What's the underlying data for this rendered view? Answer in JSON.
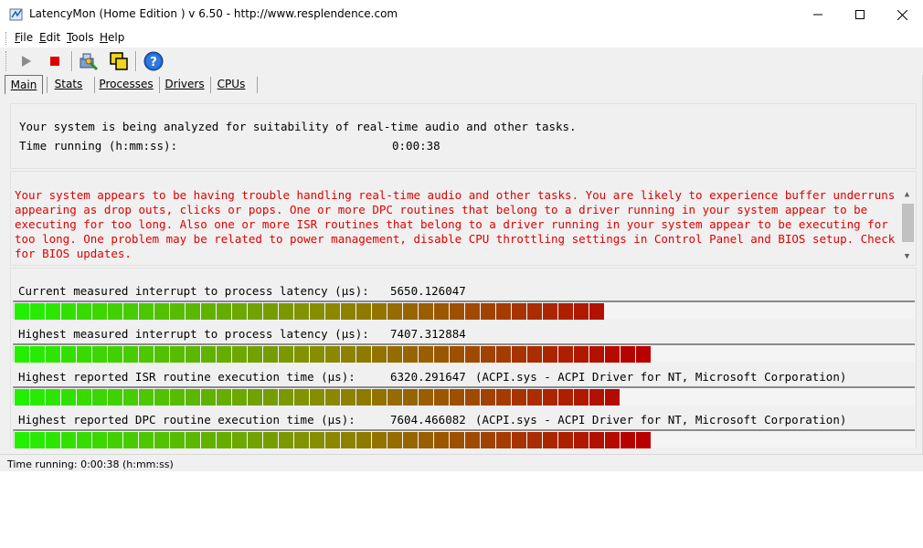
{
  "window": {
    "title": "LatencyMon  (Home Edition )  v 6.50 - http://www.resplendence.com",
    "minimize_icon": "minimize-icon",
    "maximize_icon": "maximize-icon",
    "close_icon": "close-icon"
  },
  "menu": [
    {
      "key": "F",
      "rest": "ile"
    },
    {
      "key": "E",
      "rest": "dit"
    },
    {
      "key": "T",
      "rest": "ools"
    },
    {
      "key": "H",
      "rest": "elp"
    }
  ],
  "toolbar": {
    "buttons": [
      "play-icon",
      "stop-icon",
      "driver-tool-icon",
      "window-tool-icon",
      "help-icon"
    ]
  },
  "tabs": [
    {
      "label": "Main",
      "active": true
    },
    {
      "label": "Stats",
      "active": false
    },
    {
      "label": "Processes",
      "active": false
    },
    {
      "label": "Drivers",
      "active": false
    },
    {
      "label": "CPUs",
      "active": false
    }
  ],
  "status_panel": {
    "line1": "Your system is being analyzed for suitability of real-time audio and other tasks.",
    "line2_label": "Time running (h:mm:ss):",
    "line2_value": "0:00:38"
  },
  "warning_text": "Your system appears to be having trouble handling real-time audio and other tasks. You are likely to experience buffer underruns appearing as drop outs, clicks or pops. One or more DPC routines that belong to a driver running in your system appear to be executing for too long. Also one or more ISR routines that belong to a driver running in your system appear to be executing for too long. One problem may be related to power management, disable CPU throttling settings in Control Panel and BIOS setup. Check for BIOS updates.",
  "meters": [
    {
      "label": "Current measured interrupt to process latency (µs):",
      "value": "5650.126047",
      "driver": "",
      "segments": 38
    },
    {
      "label": "Highest measured interrupt to process latency (µs):",
      "value": "7407.312884",
      "driver": "",
      "segments": 41
    },
    {
      "label": "Highest reported ISR routine execution time (µs):",
      "value": "6320.291647",
      "driver": "(ACPI.sys - ACPI Driver for NT, Microsoft Corporation)",
      "segments": 39
    },
    {
      "label": "Highest reported DPC routine execution time (µs):",
      "value": "7604.466082",
      "driver": "(ACPI.sys - ACPI Driver for NT, Microsoft Corporation)",
      "segments": 41
    }
  ],
  "statusbar": {
    "text": "Time running: 0:00:38  (h:mm:ss)"
  },
  "colors": {
    "warning": "#e00000",
    "bar_good": "#22f000",
    "bar_bad": "#b80000"
  }
}
